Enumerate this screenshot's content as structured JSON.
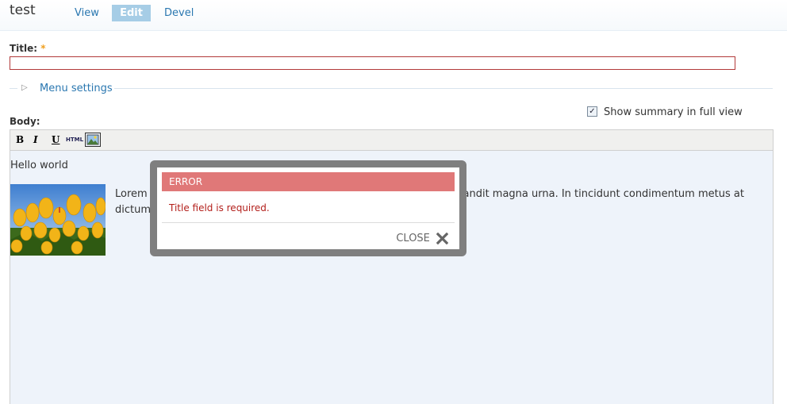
{
  "header": {
    "title": "test",
    "tabs": [
      {
        "label": "View",
        "active": false
      },
      {
        "label": "Edit",
        "active": true
      },
      {
        "label": "Devel",
        "active": false
      }
    ]
  },
  "form": {
    "title_label": "Title:",
    "required_mark": "*",
    "title_value": "",
    "menu_settings_label": "Menu settings",
    "summary_label": "Show summary in full view",
    "summary_checked": true,
    "body_label": "Body:"
  },
  "editor": {
    "toolbar": {
      "bold": "B",
      "italic": "I",
      "underline": "U",
      "html": "HTML",
      "image_icon": "image-icon"
    },
    "content": {
      "hello": "Hello world",
      "lorem": "Lorem ipsum dolor sit amet, consectetur adipiscing elit. Vivamus blandit magna urna. In tincidunt condimentum metus at dictum. Duis ut."
    }
  },
  "dialog": {
    "title": "ERROR",
    "message": "Title field is required.",
    "close_label": "CLOSE",
    "close_icon": "close-icon"
  },
  "colors": {
    "link": "#2a77b0",
    "tab_active_bg": "#a6cde6",
    "error_header": "#e07878",
    "error_text": "#b3201c",
    "dialog_frame": "#7f7f7f",
    "editor_bg": "#eef3fa"
  }
}
